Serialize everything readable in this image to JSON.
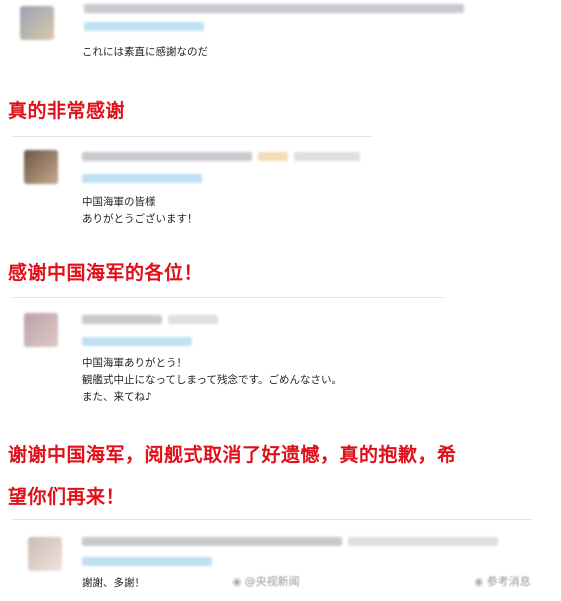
{
  "tweets": [
    {
      "text": "これには素直に感謝なのだ"
    },
    {
      "text": "中国海軍の皆様\nありがとうございます！"
    },
    {
      "text": "中国海軍ありがとう！\n観艦式中止になってしまって残念です。ごめんなさい。\nまた、来てね♪"
    },
    {
      "text": "謝謝、多謝！"
    }
  ],
  "captions": [
    "真的非常感谢",
    "感谢中国海军的各位！",
    "谢谢中国海军，阅舰式取消了好遗憾，真的抱歉，希",
    "望你们再来！"
  ],
  "watermarks": {
    "left": "@央视新闻",
    "right": "参考消息"
  }
}
